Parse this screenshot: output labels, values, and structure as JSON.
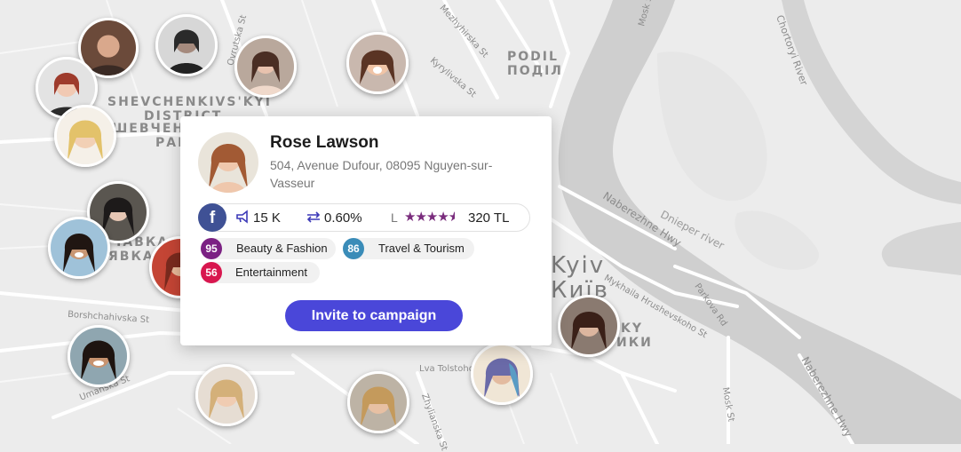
{
  "map": {
    "district_labels": [
      "PODIL",
      "ПОДІЛ",
      "SHEVCHENKIVS'KYI",
      "DISTRICT",
      "ШЕВЧЕНК",
      "РАЙ",
      "ЧАВКА",
      "ЯВКА",
      "KY",
      "ИКИ"
    ],
    "city_labels": [
      "Kyiv",
      "Київ"
    ],
    "street_labels": [
      "Naberezhne Hwy",
      "Dnieper river",
      "Chortoryi River",
      "Mykhaila Hrushevskoho St",
      "Parkova Rd",
      "Naberezhne Hwy",
      "Borshchahivska St",
      "Lva Tolstoho St",
      "Mezhyhirska St",
      "Kyrylivska St",
      "Ovrutska St",
      "Umanska St",
      "Mosk St",
      "Mosk St",
      "Zhylianska St"
    ]
  },
  "influencer": {
    "name": "Rose Lawson",
    "address": "504, Avenue Dufour, 08095 Nguyen-sur-Vasseur",
    "network": "f",
    "reach": "15 K",
    "engagement": "0.60%",
    "level_label": "L",
    "rating": 4.5,
    "price": "320 TL",
    "categories": [
      {
        "score": "95",
        "label": "Beauty & Fashion",
        "color": "#7b2183"
      },
      {
        "score": "86",
        "label": "Travel & Tourism",
        "color": "#3a8cb8"
      },
      {
        "score": "56",
        "label": "Entertainment",
        "color": "#d8174f"
      }
    ]
  },
  "actions": {
    "invite_label": "Invite to campaign"
  },
  "colors": {
    "accent": "#4a47d9",
    "facebook": "#3f5195",
    "map_bg": "#ececec",
    "river": "#cfcfcf"
  }
}
